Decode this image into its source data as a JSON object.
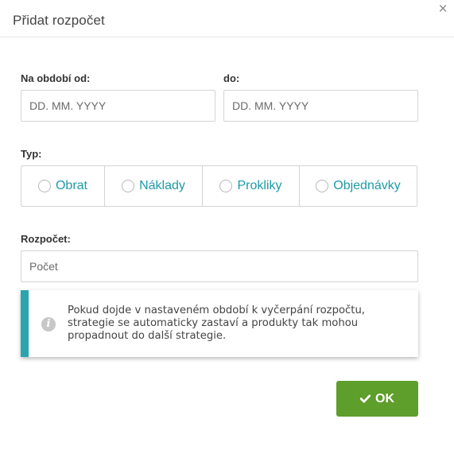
{
  "dialog": {
    "title": "Přidat rozpočet",
    "close_label": "×"
  },
  "period": {
    "from_label": "Na období od:",
    "from_placeholder": "DD. MM. YYYY",
    "to_label": "do:",
    "to_placeholder": "DD. MM. YYYY"
  },
  "type": {
    "label": "Typ:",
    "options": [
      {
        "label": "Obrat",
        "selected": false
      },
      {
        "label": "Náklady",
        "selected": false
      },
      {
        "label": "Prokliky",
        "selected": false
      },
      {
        "label": "Objednávky",
        "selected": false
      }
    ]
  },
  "budget": {
    "label": "Rozpočet:",
    "placeholder": "Počet"
  },
  "info": {
    "icon": "info-icon",
    "text": "Pokud dojde v nastaveném období k vyčerpání rozpočtu, strategie se automaticky zastaví a produkty tak mohou propadnout do další strategie."
  },
  "actions": {
    "ok_label": "OK",
    "ok_icon": "check-icon"
  },
  "colors": {
    "accent": "#1e9aa7",
    "info_bar": "#2aa4ad",
    "ok_button": "#5e9e2b"
  }
}
